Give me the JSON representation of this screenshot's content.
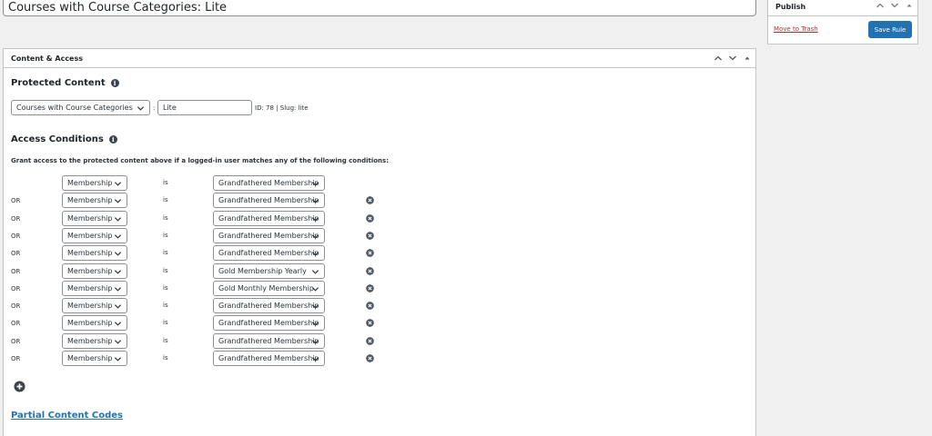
{
  "post_title": "Courses with Course Categories: Lite",
  "metabox": {
    "title": "Content & Access"
  },
  "protected_content": {
    "title": "Protected Content",
    "type_select": "Courses with Course Categories",
    "separator": ":",
    "term_value": "Lite",
    "meta": "ID: 78 | Slug: lite"
  },
  "access_conditions": {
    "title": "Access Conditions",
    "description": "Grant access to the protected content above if a logged-in user matches any of the following conditions:",
    "rows": [
      {
        "prefix": "",
        "field": "Membership",
        "operator": "is",
        "value": "Grandfathered Membership"
      },
      {
        "prefix": "OR",
        "field": "Membership",
        "operator": "is",
        "value": "Grandfathered Membership"
      },
      {
        "prefix": "OR",
        "field": "Membership",
        "operator": "is",
        "value": "Grandfathered Membership"
      },
      {
        "prefix": "OR",
        "field": "Membership",
        "operator": "is",
        "value": "Grandfathered Membership"
      },
      {
        "prefix": "OR",
        "field": "Membership",
        "operator": "is",
        "value": "Grandfathered Membership"
      },
      {
        "prefix": "OR",
        "field": "Membership",
        "operator": "is",
        "value": "Gold Membership Yearly"
      },
      {
        "prefix": "OR",
        "field": "Membership",
        "operator": "is",
        "value": "Gold Monthly Membership"
      },
      {
        "prefix": "OR",
        "field": "Membership",
        "operator": "is",
        "value": "Grandfathered Membership"
      },
      {
        "prefix": "OR",
        "field": "Membership",
        "operator": "is",
        "value": "Grandfathered Membership"
      },
      {
        "prefix": "OR",
        "field": "Membership",
        "operator": "is",
        "value": "Grandfathered Membership"
      },
      {
        "prefix": "OR",
        "field": "Membership",
        "operator": "is",
        "value": "Grandfathered Membership"
      }
    ]
  },
  "partial_content": {
    "title": "Partial Content Codes"
  },
  "publish": {
    "title": "Publish",
    "trash_label": "Move to Trash",
    "save_label": "Save Rule"
  },
  "colors": {
    "accent": "#2271b1",
    "danger": "#b32d2e",
    "border": "#c3c4c7",
    "background": "#f0f0f1"
  },
  "icons": [
    "chevron-up-icon",
    "chevron-down-icon",
    "toggle-arrow-icon",
    "info-icon",
    "remove-circle-icon",
    "add-circle-icon"
  ]
}
